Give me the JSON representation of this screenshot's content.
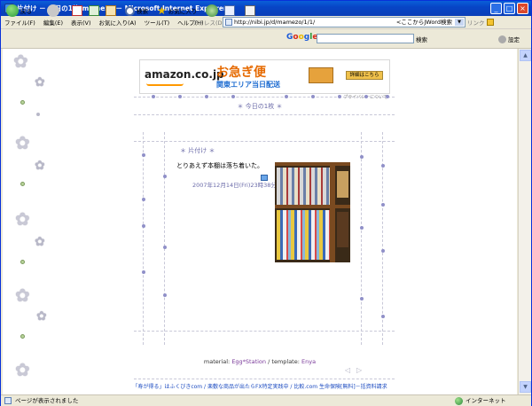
{
  "window": {
    "title": "片付け － 今日の1枚-mamezo － Microsoft Internet Explorer"
  },
  "menu": {
    "items": [
      "ファイル(F)",
      "編集(E)",
      "表示(V)",
      "お気に入り(A)",
      "ツール(T)",
      "ヘルプ(H)"
    ]
  },
  "address": {
    "label": "アドレス(D)",
    "url": "http://nibi.jp/d/mamezo/1/1/",
    "go_text": "<ここからJWord検索",
    "links_label": "リンク"
  },
  "toolbar": {
    "back": "戻る",
    "search": "検索",
    "favorites": "お気に入り",
    "google": "Google",
    "google_search": "検索",
    "settings": "設定"
  },
  "page": {
    "banner": {
      "brand": "amazon.co.jp",
      "headline": "お急ぎ便",
      "subline": "関東エリア当日配送",
      "button": "詳細はこちら",
      "privacy": "プライバシーについて"
    },
    "section_title": "＊ 今日の1枚 ＊",
    "entry": {
      "title": "＊ 片付け ＊",
      "body": "とりあえず本棚は落ち着いた。",
      "date": "2007年12月14日(Fri)23時38分"
    },
    "credit": {
      "material_label": "material:",
      "material": "Egg*Station",
      "sep": "/",
      "template_label": "template:",
      "template": "Enya"
    },
    "footer_links": "「寿が得る」はふくびきcom / 楽敷な商品が出たらFX特定実践中 / 比較.com 生命保険[無料]－括資料請求"
  },
  "status": {
    "text": "ページが表示されました",
    "zone": "インターネット"
  }
}
